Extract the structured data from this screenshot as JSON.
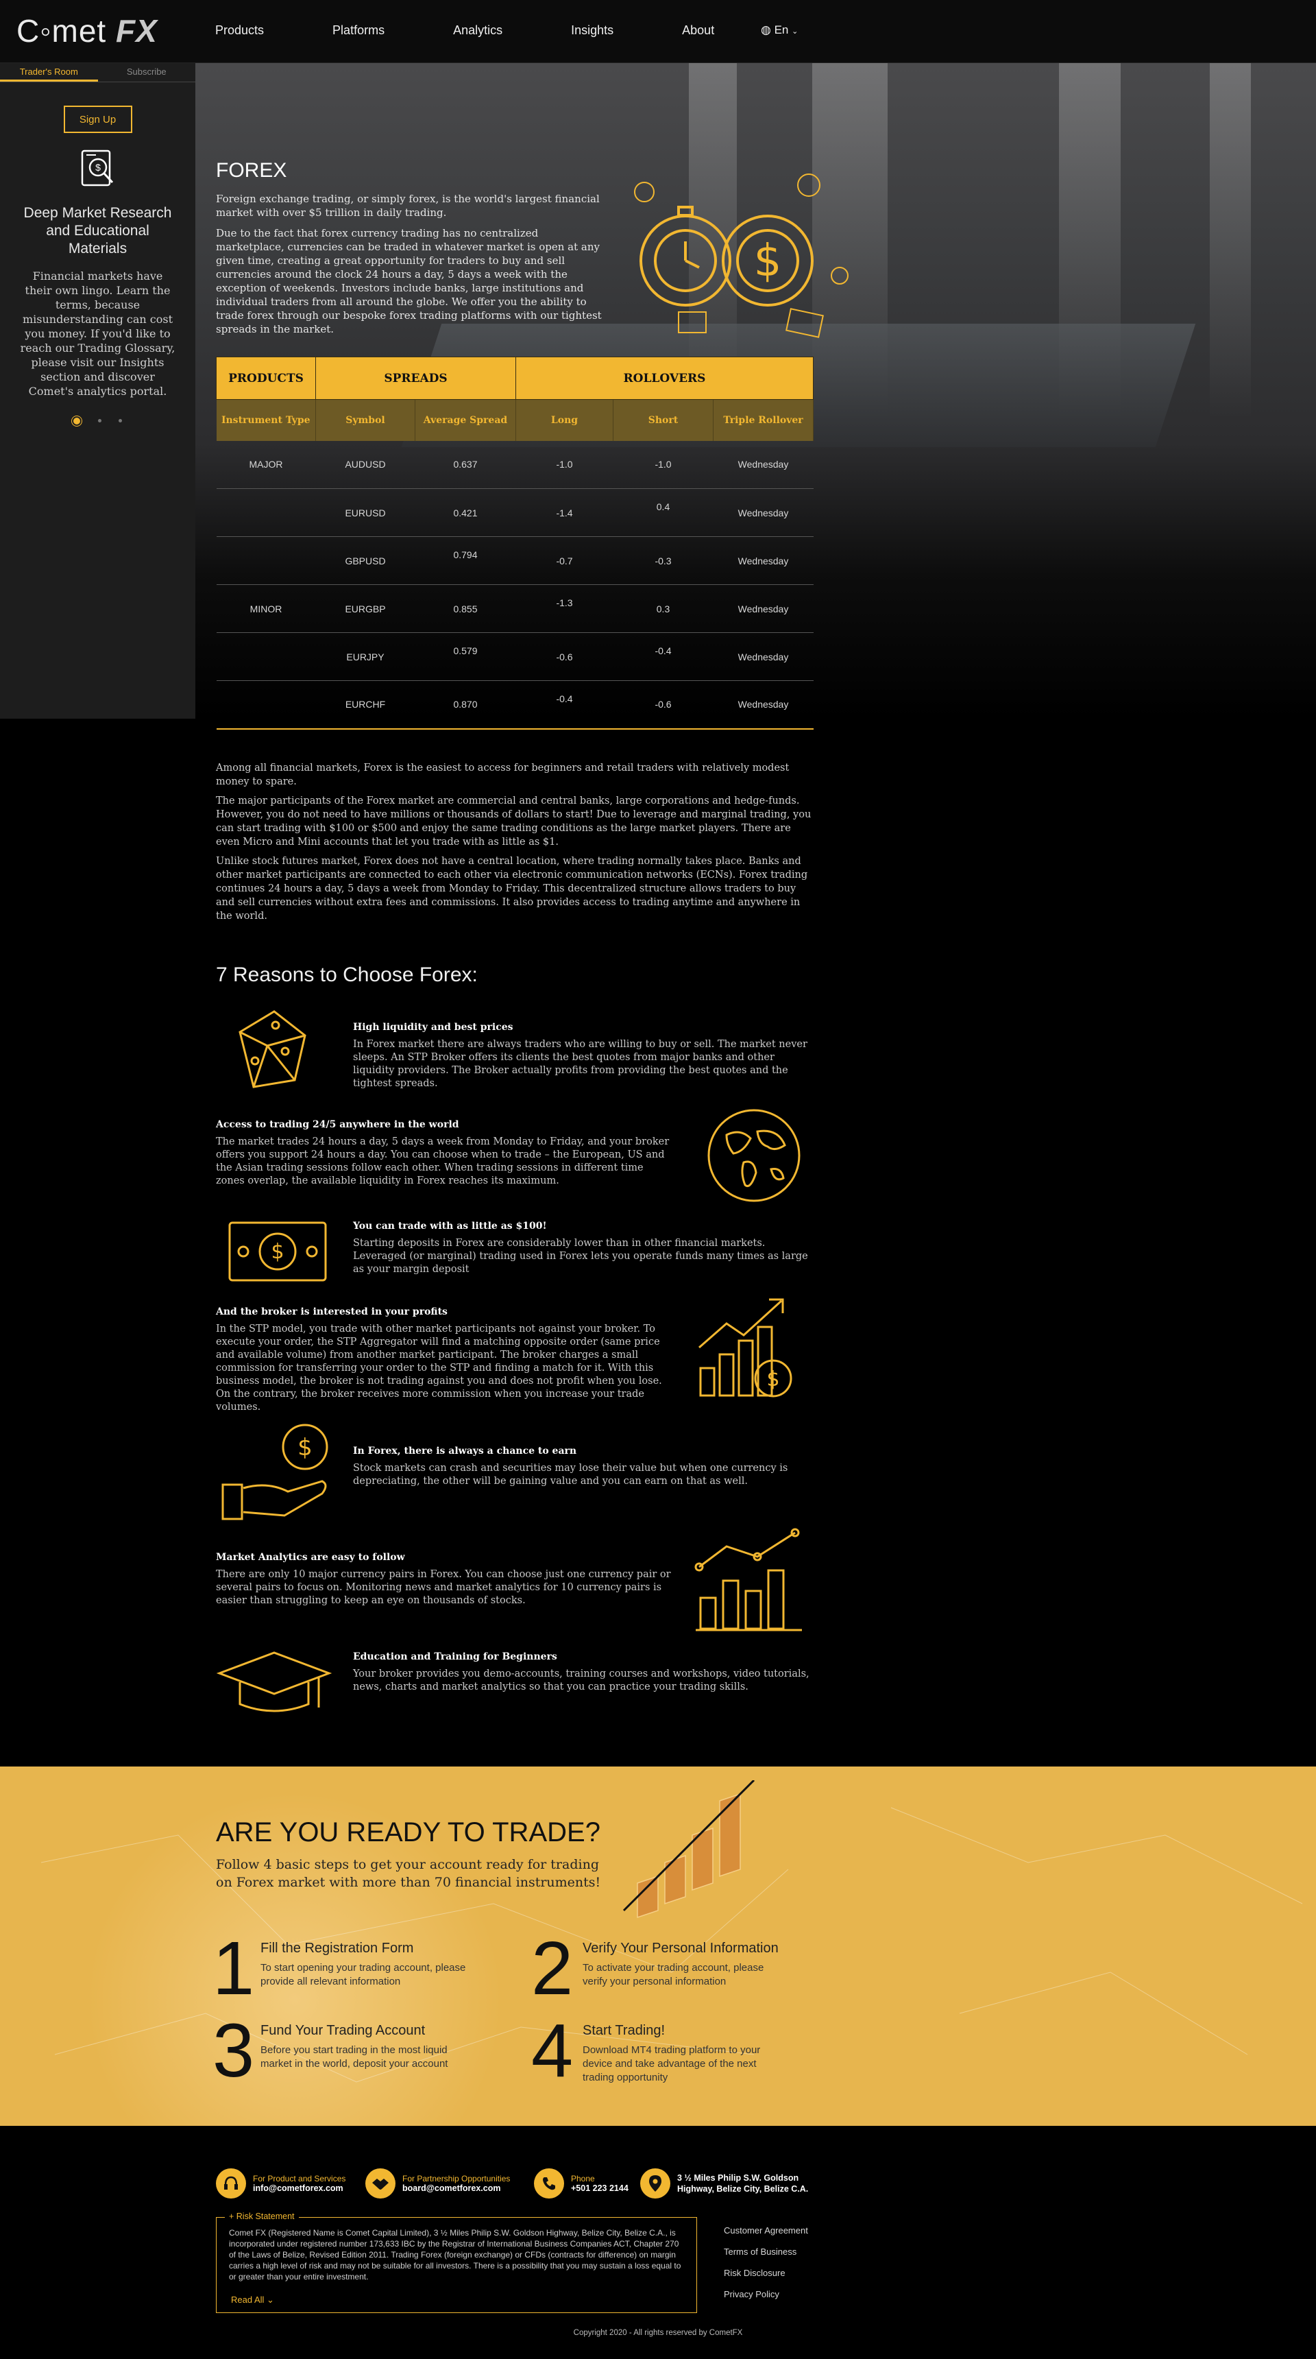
{
  "header": {
    "logo_main": "C◦met",
    "logo_fx": "FX",
    "nav": [
      "Products",
      "Platforms",
      "Analytics",
      "Insights",
      "About"
    ],
    "lang": "En"
  },
  "sidebar": {
    "tabs": [
      "Trader's Room",
      "Subscribe"
    ],
    "signup": "Sign Up",
    "title": "Deep Market Research and Educational Materials",
    "text": "Financial markets have their own lingo. Learn the terms, because misunderstanding can cost you money. If you'd like to reach our Trading Glossary, please visit our Insights section and discover Comet's analytics portal."
  },
  "hero": {
    "title": "FOREX",
    "p1": "Foreign exchange trading, or simply forex, is the world's largest financial market with over $5 trillion in daily trading.",
    "p2": "Due to the fact that forex currency trading has no centralized marketplace, currencies can be traded in whatever market is open at any given time, creating a great opportunity for traders to buy and sell currencies around the clock 24 hours a day, 5 days a week with the exception of weekends. Investors include banks, large institutions and individual traders from all around the globe. We offer you the ability to trade forex through our bespoke forex trading platforms with our tightest spreads in the market."
  },
  "table": {
    "groups": [
      "PRODUCTS",
      "SPREADS",
      "ROLLOVERS"
    ],
    "columns": [
      "Instrument Type",
      "Symbol",
      "Average Spread",
      "Long",
      "Short",
      "Triple Rollover"
    ],
    "rows": [
      [
        "MAJOR",
        "AUDUSD",
        "0.637",
        "-1.0",
        "-1.0",
        "Wednesday"
      ],
      [
        "",
        "EURUSD",
        "0.421",
        "-1.4",
        "0.4",
        "Wednesday"
      ],
      [
        "",
        "GBPUSD",
        "0.794",
        "-0.7",
        "-0.3",
        "Wednesday"
      ],
      [
        "MINOR",
        "EURGBP",
        "0.855",
        "-1.3",
        "0.3",
        "Wednesday"
      ],
      [
        "",
        "EURJPY",
        "0.579",
        "-0.6",
        "-0.4",
        "Wednesday"
      ],
      [
        "",
        "EURCHF",
        "0.870",
        "-0.4",
        "-0.6",
        "Wednesday"
      ]
    ]
  },
  "intro": [
    "Among all financial markets, Forex is the easiest to access for beginners and retail traders with relatively modest money to spare.",
    "The major participants of the Forex market are commercial and central banks, large corporations and hedge-funds. However, you do not need to have millions or thousands of dollars to start! Due to leverage and marginal trading, you can start trading with $100 or $500 and enjoy the same trading conditions as the large market players. There are even Micro and Mini accounts that let you trade with as little as $1.",
    "Unlike stock futures market, Forex does not have a central location, where trading normally takes place. Banks and other market participants are connected to each other via electronic communication networks (ECNs). Forex trading continues 24 hours a day, 5 days a week from Monday to Friday. This decentralized structure allows traders to buy and sell currencies without extra fees and commissions. It also provides access to trading anytime and anywhere in the world."
  ],
  "reasons": {
    "title": "7 Reasons to Choose Forex:",
    "items": [
      {
        "title": "High liquidity and best prices",
        "text": "In Forex market there are always traders who are willing to buy or sell. The market never sleeps. An STP Broker offers its clients the best quotes from major banks and other liquidity providers. The Broker actually profits from providing the best quotes and the tightest spreads.",
        "icon": "dice-icon"
      },
      {
        "title": "Access to trading 24/5 anywhere in the world",
        "text": "The market trades 24 hours a day, 5 days a week from Monday to Friday, and your broker offers you support 24 hours a day. You can choose when to trade – the European, US and the Asian trading sessions follow each other. When trading sessions in different time zones overlap, the available liquidity in Forex reaches its maximum.",
        "icon": "globe-icon"
      },
      {
        "title": "You can trade with as little as $100!",
        "text": "Starting deposits in Forex are considerably lower than in other financial markets. Leveraged (or marginal) trading used in Forex lets you operate funds many times as large as your margin deposit",
        "icon": "banknote-icon"
      },
      {
        "title": "And the broker is interested in your profits",
        "text": "In the STP model, you trade with other market participants not against your broker. To execute your order, the STP Aggregator will find a matching opposite order (same price and available volume) from another market participant. The broker charges a small commission for transferring your order to the STP and finding a match for it. With this business model, the broker is not trading against you and does not profit when you lose. On the contrary, the broker receives more commission when you increase your trade volumes.",
        "icon": "growth-chart-icon"
      },
      {
        "title": "In Forex, there is always a chance to earn",
        "text": "Stock markets can crash and securities may lose their value but when one currency is depreciating, the other will be gaining value and you can earn on that as well.",
        "icon": "hand-coin-icon"
      },
      {
        "title": "Market Analytics are easy to follow",
        "text": "There are only 10 major currency pairs in Forex. You can choose just one currency pair or several pairs to focus on. Monitoring news and market analytics for 10 currency pairs is easier than struggling to keep an eye on thousands of stocks.",
        "icon": "analytics-chart-icon"
      },
      {
        "title": "Education and Training for Beginners",
        "text": "Your broker provides you demo-accounts, training courses and workshops, video tutorials, news, charts and market analytics so that you can practice your trading skills.",
        "icon": "graduation-cap-icon"
      }
    ]
  },
  "ready": {
    "title": "ARE YOU READY TO TRADE?",
    "subtitle": "Follow 4 basic steps to get your account ready for trading on Forex market with more than 70 financial instruments!",
    "steps": [
      {
        "num": "1",
        "title": "Fill the Registration Form",
        "text": "To start opening your trading account, please provide all relevant information"
      },
      {
        "num": "2",
        "title": "Verify Your Personal Information",
        "text": "To activate your trading account, please verify your personal information"
      },
      {
        "num": "3",
        "title": "Fund Your Trading Account",
        "text": "Before you start trading in the most liquid market in the world, deposit your account"
      },
      {
        "num": "4",
        "title": "Start Trading!",
        "text": "Download MT4 trading platform to your device and take advantage of the next trading opportunity"
      }
    ]
  },
  "footer": {
    "contacts": [
      {
        "label": "For Product and Services",
        "value": "info@cometforex.com",
        "icon": "headset-icon"
      },
      {
        "label": "For Partnership Opportunities",
        "value": "board@cometforex.com",
        "icon": "handshake-icon"
      },
      {
        "label": "Phone",
        "value": "+501 223 2144",
        "icon": "phone-icon"
      },
      {
        "label": "",
        "value": "3 ½ Miles Philip S.W. Goldson Highway, Belize City, Belize C.A.",
        "icon": "location-icon"
      }
    ],
    "risk_label": "+ Risk Statement",
    "risk_text": "Comet FX (Registered Name is Comet Capital Limited), 3 ½ Miles Philip S.W. Goldson Highway, Belize City, Belize C.A., is incorporated under registered number 173,633 IBC by the Registrar of International Business Companies ACT, Chapter 270 of the Laws of Belize, Revised Edition 2011. Trading Forex (foreign exchange) or CFDs (contracts for difference) on margin carries a high level of risk and may not be suitable for all investors. There is a possibility that you may sustain a loss equal to or greater than your entire investment.",
    "read_all": "Read All ⌄",
    "links": [
      "Customer Agreement",
      "Terms of Business",
      "Risk Disclosure",
      "Privacy Policy"
    ],
    "copyright": "Copyright 2020 - All rights reserved by CometFX"
  }
}
